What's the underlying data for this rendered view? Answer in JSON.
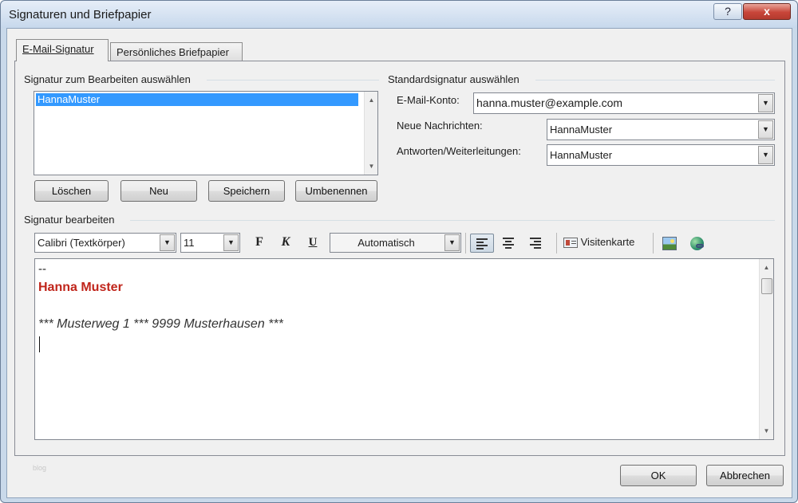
{
  "window": {
    "title": "Signaturen und Briefpapier"
  },
  "titlebar": {
    "help": "?",
    "close": "x"
  },
  "tabs": [
    {
      "label": "E-Mail-Signatur"
    },
    {
      "label": "Persönliches Briefpapier"
    }
  ],
  "select_section": {
    "label": "Signatur zum Bearbeiten auswählen",
    "items": [
      "HannaMuster"
    ],
    "buttons": {
      "delete": "Löschen",
      "new": "Neu",
      "save": "Speichern",
      "rename": "Umbenennen"
    }
  },
  "default_section": {
    "label": "Standardsignatur auswählen",
    "account_label": "E-Mail-Konto:",
    "account_value": "hanna.muster@example.com",
    "new_messages_label": "Neue Nachrichten:",
    "new_messages_value": "HannaMuster",
    "replies_label": "Antworten/Weiterleitungen:",
    "replies_value": "HannaMuster"
  },
  "edit_section": {
    "label": "Signatur bearbeiten",
    "font": "Calibri (Textkörper)",
    "size": "11",
    "bold": "F",
    "italic": "K",
    "underline": "U",
    "color": "Automatisch",
    "business_card": "Visitenkarte",
    "signature_lines": [
      "--",
      "Hanna Muster",
      "",
      "*** Musterweg 1 *** 9999 Musterhausen ***"
    ],
    "name_color": "#c0251b"
  },
  "footer": {
    "note": "blog",
    "ok": "OK",
    "cancel": "Abbrechen"
  }
}
